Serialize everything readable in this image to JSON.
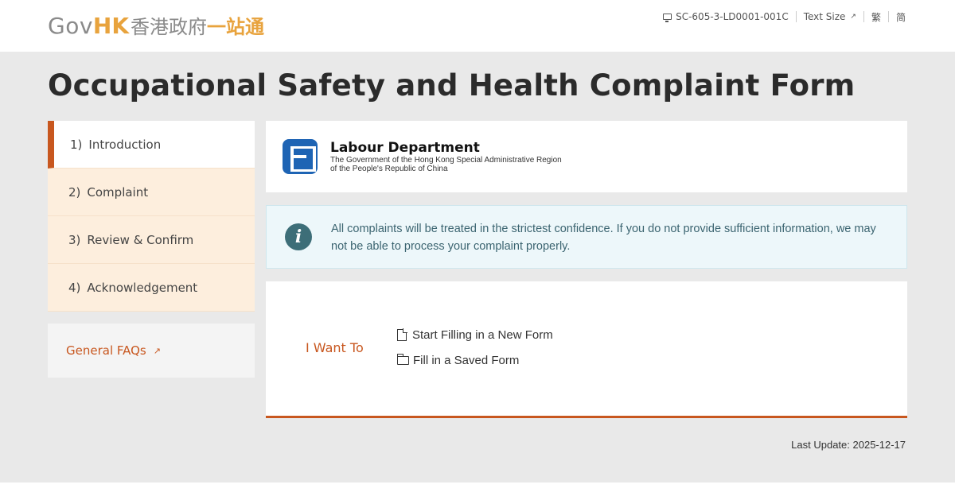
{
  "header": {
    "logo_gov": "Gov",
    "logo_hk": "HK",
    "logo_zh": "香港政府",
    "logo_zh2": "一站通",
    "form_code": "SC-605-3-LD0001-001C",
    "text_size_label": "Text Size",
    "lang_trad": "繁",
    "lang_simp": "简"
  },
  "page": {
    "title": "Occupational Safety and Health Complaint Form",
    "last_update": "Last Update: 2025-12-17"
  },
  "steps": [
    {
      "num": "1)",
      "label": "Introduction"
    },
    {
      "num": "2)",
      "label": "Complaint"
    },
    {
      "num": "3)",
      "label": "Review & Confirm"
    },
    {
      "num": "4)",
      "label": "Acknowledgement"
    }
  ],
  "sidebar": {
    "faq_label": "General FAQs"
  },
  "department": {
    "name": "Labour Department",
    "sub_line1": "The Government of the Hong Kong Special Administrative Region",
    "sub_line2": "of the People's Republic of China"
  },
  "notice": {
    "text": "All complaints will be treated in the strictest confidence. If you do not provide sufficient information, we may not be able to process your complaint properly."
  },
  "want": {
    "label": "I Want To",
    "option_new": "Start Filling in a New Form",
    "option_saved": "Fill in a Saved Form"
  },
  "colors": {
    "accent": "#c8571f",
    "step_bg": "#fdeedd",
    "info_bg": "#edf7fa",
    "dept_blue": "#1e64b4"
  },
  "icons": [
    "monitor-icon",
    "external-link-icon",
    "info-icon",
    "file-icon",
    "folder-open-icon",
    "labour-department-logo"
  ]
}
